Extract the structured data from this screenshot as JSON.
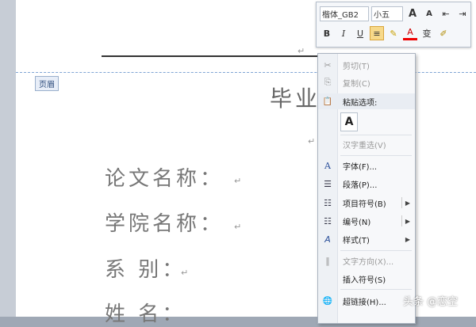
{
  "header": {
    "tag_label": "页眉"
  },
  "document": {
    "title": "毕业论",
    "rows": [
      {
        "label": "论文名称："
      },
      {
        "label": "学院名称："
      },
      {
        "label": "系 别："
      },
      {
        "label": "姓 名："
      }
    ],
    "para_mark": "↵"
  },
  "minibar": {
    "font_family": "楷体_GB2",
    "font_size": "小五",
    "grow_font": "A",
    "shrink_font": "A",
    "indent_decrease": "⇤",
    "indent_increase": "⇥",
    "bold": "B",
    "italic": "I",
    "underline": "U",
    "align": "≡",
    "highlight": "✎",
    "font_color": "A",
    "phonetic": "变",
    "format_painter": "✐"
  },
  "context_menu": {
    "items": [
      {
        "label": "剪切(T)",
        "icon": "scissors-icon",
        "glyph": "✂",
        "disabled": true
      },
      {
        "label": "复制(C)",
        "icon": "copy-icon",
        "glyph": "⎘",
        "disabled": true
      },
      {
        "label": "粘贴选项:",
        "icon": "paste-icon",
        "glyph": "📋",
        "disabled": false
      },
      {
        "label": "汉字重选(V)",
        "icon": "",
        "glyph": "",
        "disabled": true
      },
      {
        "label": "字体(F)...",
        "icon": "font-icon",
        "glyph": "A",
        "disabled": false
      },
      {
        "label": "段落(P)...",
        "icon": "paragraph-icon",
        "glyph": "☰",
        "disabled": false
      },
      {
        "label": "项目符号(B)",
        "icon": "bullets-icon",
        "glyph": "☷",
        "disabled": false,
        "submenu": true
      },
      {
        "label": "编号(N)",
        "icon": "numbering-icon",
        "glyph": "☷",
        "disabled": false,
        "submenu": true
      },
      {
        "label": "样式(T)",
        "icon": "styles-icon",
        "glyph": "A",
        "disabled": false,
        "submenu": true
      },
      {
        "label": "文字方向(X)...",
        "icon": "text-direction-icon",
        "glyph": "‖",
        "disabled": true
      },
      {
        "label": "插入符号(S)",
        "icon": "",
        "glyph": "",
        "disabled": false
      },
      {
        "label": "超链接(H)...",
        "icon": "hyperlink-icon",
        "glyph": "🌐",
        "disabled": false
      }
    ],
    "paste_keep_text": "A",
    "submenu_arrow": "▶"
  },
  "watermark": "头条 @恋空"
}
